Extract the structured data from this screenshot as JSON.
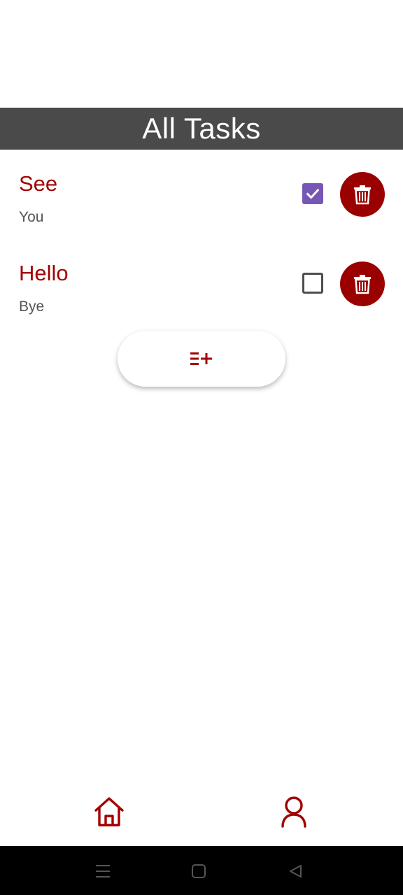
{
  "header": {
    "title": "All Tasks"
  },
  "tasks": [
    {
      "title": "See",
      "description": "You",
      "checked": true
    },
    {
      "title": "Hello",
      "description": "Bye",
      "checked": false
    }
  ],
  "icons": {
    "delete": "trash-icon",
    "add": "playlist-add-icon",
    "nav_home": "home-icon",
    "nav_profile": "person-icon",
    "sys_menu": "menu-icon",
    "sys_home": "square-icon",
    "sys_back": "back-triangle-icon"
  },
  "colors": {
    "header_bg": "#4a4a4a",
    "accent": "#9a0000",
    "checkbox_checked": "#7657b5"
  }
}
